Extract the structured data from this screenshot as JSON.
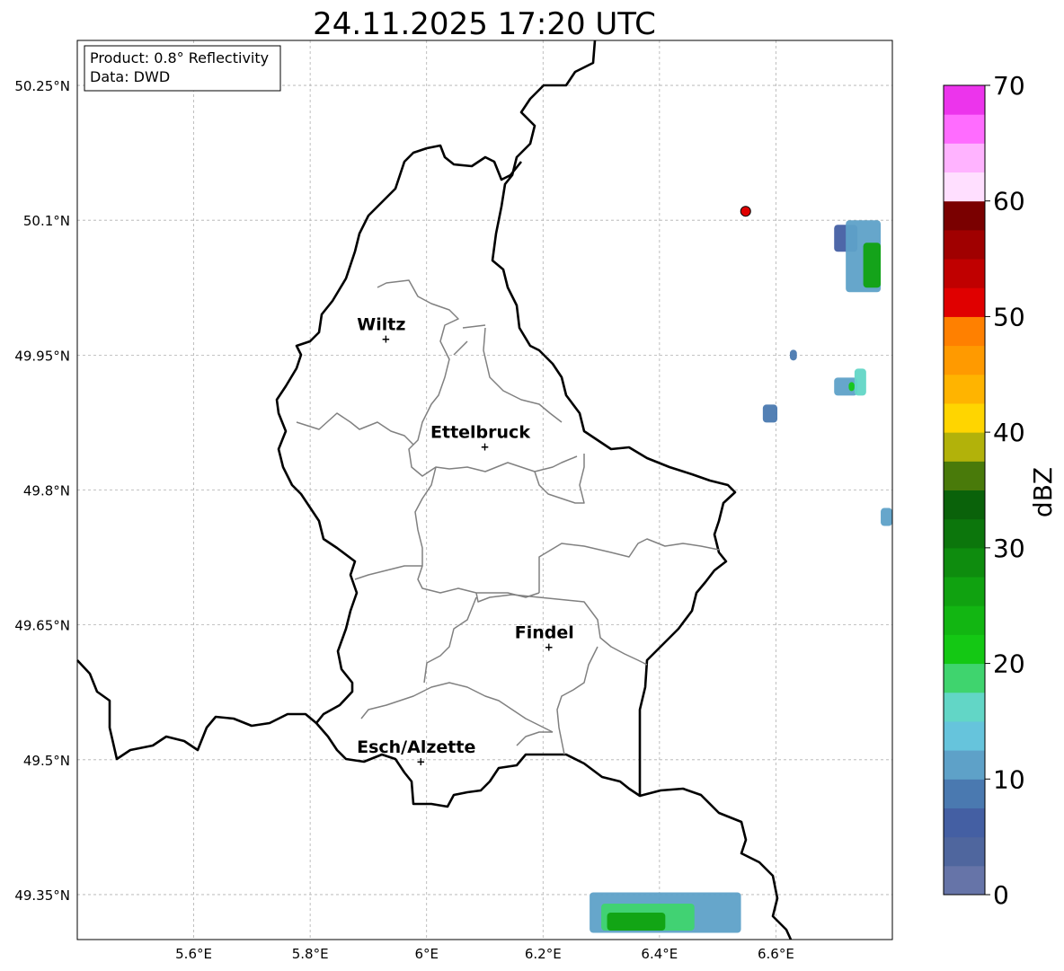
{
  "title": "24.11.2025 17:20 UTC",
  "info": {
    "product": "Product: 0.8° Reflectivity",
    "data": "Data: DWD"
  },
  "map": {
    "lon_range": [
      5.4,
      6.8
    ],
    "lat_range": [
      49.3,
      50.3
    ],
    "lon_ticks": [
      {
        "value": 5.6,
        "label": "5.6°E"
      },
      {
        "value": 5.8,
        "label": "5.8°E"
      },
      {
        "value": 6.0,
        "label": "6°E"
      },
      {
        "value": 6.2,
        "label": "6.2°E"
      },
      {
        "value": 6.4,
        "label": "6.4°E"
      },
      {
        "value": 6.6,
        "label": "6.6°E"
      }
    ],
    "lat_ticks": [
      {
        "value": 50.25,
        "label": "50.25°N"
      },
      {
        "value": 50.1,
        "label": "50.1°N"
      },
      {
        "value": 49.95,
        "label": "49.95°N"
      },
      {
        "value": 49.8,
        "label": "49.8°N"
      },
      {
        "value": 49.65,
        "label": "49.65°N"
      },
      {
        "value": 49.5,
        "label": "49.5°N"
      },
      {
        "value": 49.35,
        "label": "49.35°N"
      }
    ],
    "grid": true,
    "cities": [
      {
        "name": "Wiltz",
        "lon": 5.93,
        "lat": 49.968
      },
      {
        "name": "Ettelbruck",
        "lon": 6.1,
        "lat": 49.848
      },
      {
        "name": "Findel",
        "lon": 6.21,
        "lat": 49.625
      },
      {
        "name": "Esch/Alzette",
        "lon": 5.99,
        "lat": 49.498
      }
    ],
    "radar_site": {
      "lon": 6.548,
      "lat": 50.11,
      "color": "#e00000"
    }
  },
  "colorbar": {
    "label": "dBZ",
    "min": 0,
    "max": 70,
    "step": 2.5,
    "tick_labels": [
      "0",
      "10",
      "20",
      "30",
      "40",
      "50",
      "60",
      "70"
    ],
    "colors": [
      "#6674a8",
      "#4f669e",
      "#445fa3",
      "#4a79b0",
      "#5ea1c8",
      "#66c4dc",
      "#62d6c6",
      "#3fd46e",
      "#14c814",
      "#12b612",
      "#10a210",
      "#0e8c0e",
      "#0c760c",
      "#0a620a",
      "#497a0a",
      "#b2b20a",
      "#ffd500",
      "#ffb400",
      "#ff9a00",
      "#ff8000",
      "#e00000",
      "#c00000",
      "#a00000",
      "#7a0000",
      "#ffdfff",
      "#ffb3ff",
      "#ff6cff",
      "#ec34ec"
    ]
  },
  "echoes": [
    {
      "lon": 6.72,
      "lat": 50.08,
      "w": 0.04,
      "h": 0.03,
      "dbz": 5
    },
    {
      "lon": 6.75,
      "lat": 50.06,
      "w": 0.06,
      "h": 0.08,
      "dbz": 10
    },
    {
      "lon": 6.765,
      "lat": 50.05,
      "w": 0.03,
      "h": 0.05,
      "dbz": 25
    },
    {
      "lon": 6.72,
      "lat": 49.915,
      "w": 0.04,
      "h": 0.02,
      "dbz": 10
    },
    {
      "lon": 6.745,
      "lat": 49.92,
      "w": 0.02,
      "h": 0.03,
      "dbz": 15
    },
    {
      "lon": 6.73,
      "lat": 49.915,
      "w": 0.01,
      "h": 0.01,
      "dbz": 22
    },
    {
      "lon": 6.59,
      "lat": 49.885,
      "w": 0.025,
      "h": 0.02,
      "dbz": 8
    },
    {
      "lon": 6.79,
      "lat": 49.77,
      "w": 0.02,
      "h": 0.02,
      "dbz": 10
    },
    {
      "lon": 6.63,
      "lat": 49.95,
      "w": 0.012,
      "h": 0.012,
      "dbz": 8
    },
    {
      "lon": 6.41,
      "lat": 49.33,
      "w": 0.26,
      "h": 0.045,
      "dbz": 12
    },
    {
      "lon": 6.38,
      "lat": 49.325,
      "w": 0.16,
      "h": 0.03,
      "dbz": 18
    },
    {
      "lon": 6.36,
      "lat": 49.32,
      "w": 0.1,
      "h": 0.02,
      "dbz": 25
    }
  ]
}
